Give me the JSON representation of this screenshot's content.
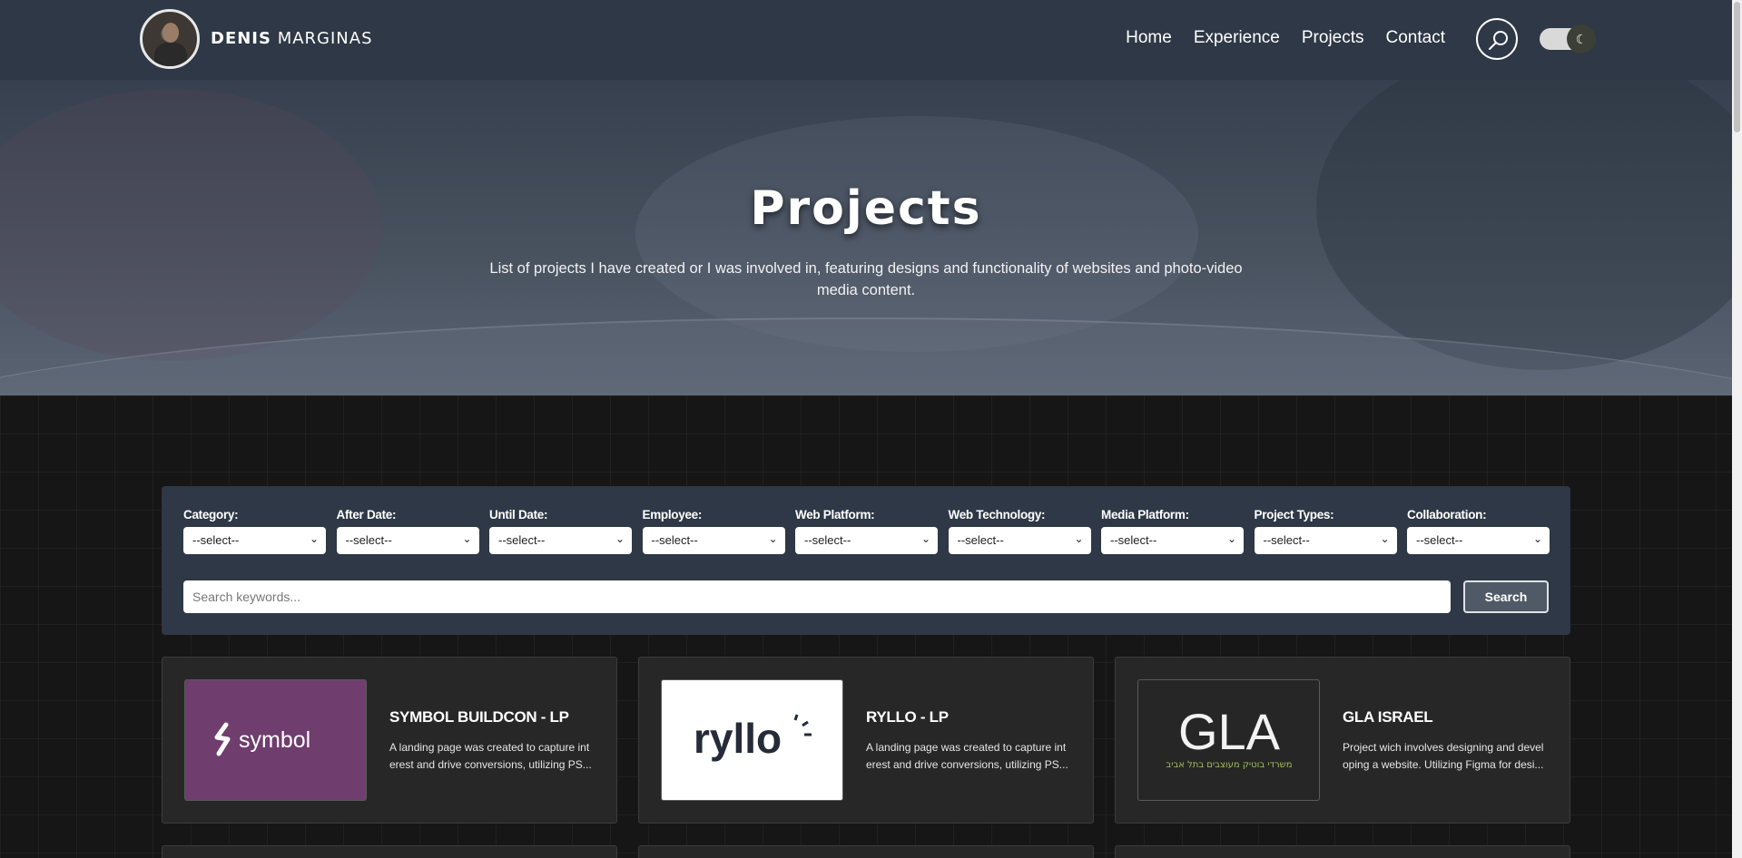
{
  "header": {
    "brand_first": "DENIS",
    "brand_last": "MARGINAS",
    "nav": [
      "Home",
      "Experience",
      "Projects",
      "Contact"
    ],
    "theme_toggle_glyph": "☾"
  },
  "hero": {
    "title": "Projects",
    "description": "List of projects I have created or I was involved in, featuring designs and functionality of websites and photo-video media content."
  },
  "filters": {
    "items": [
      {
        "label": "Category:",
        "value": "--select--"
      },
      {
        "label": "After Date:",
        "value": "--select--"
      },
      {
        "label": "Until Date:",
        "value": "--select--"
      },
      {
        "label": "Employee:",
        "value": "--select--"
      },
      {
        "label": "Web Platform:",
        "value": "--select--"
      },
      {
        "label": "Web Technology:",
        "value": "--select--"
      },
      {
        "label": "Media Platform:",
        "value": "--select--"
      },
      {
        "label": "Project Types:",
        "value": "--select--"
      },
      {
        "label": "Collaboration:",
        "value": "--select--"
      }
    ],
    "search_placeholder": "Search keywords...",
    "search_button": "Search"
  },
  "projects": [
    {
      "title": "SYMBOL BUILDCON - LP",
      "description": "A landing page was created to capture int erest and drive conversions, utilizing PS...",
      "logo_text": "symbol",
      "logo_bg": "#6f3d6e"
    },
    {
      "title": "RYLLO - LP",
      "description": "A landing page was created to capture int erest and drive conversions, utilizing PS...",
      "logo_text": "ryllo",
      "logo_bg": "#ffffff"
    },
    {
      "title": "GLA ISRAEL",
      "description": "Project wich involves designing and devel oping a website. Utilizing Figma for desi...",
      "logo_text": "GLA",
      "logo_subtext": "משרדי בוטיק מעוצבים בתל אביב",
      "logo_bg": "#262626"
    }
  ]
}
